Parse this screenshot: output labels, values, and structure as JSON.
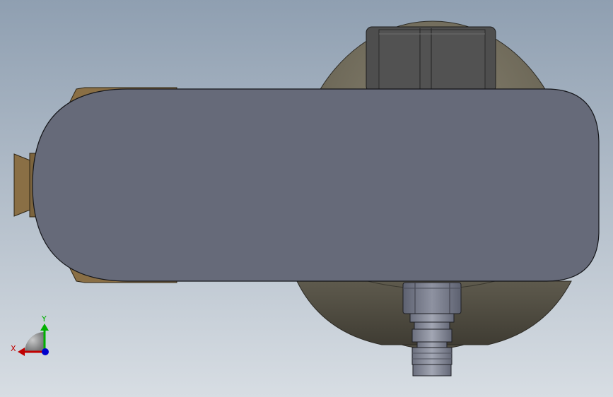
{
  "viewport": {
    "background_top": "#8f9fb1",
    "background_bottom": "#d7dde3"
  },
  "model": {
    "housing_color": "#666a79",
    "dome_color": "#6f6a5c",
    "brass_color": "#8a6f45",
    "connector_color": "#4f4f4f",
    "fitting_color": "#7d8190"
  },
  "triad": {
    "x_label": "X",
    "y_label": "Y",
    "x_color": "#c00000",
    "y_color": "#00b000",
    "z_color": "#0000cc"
  }
}
